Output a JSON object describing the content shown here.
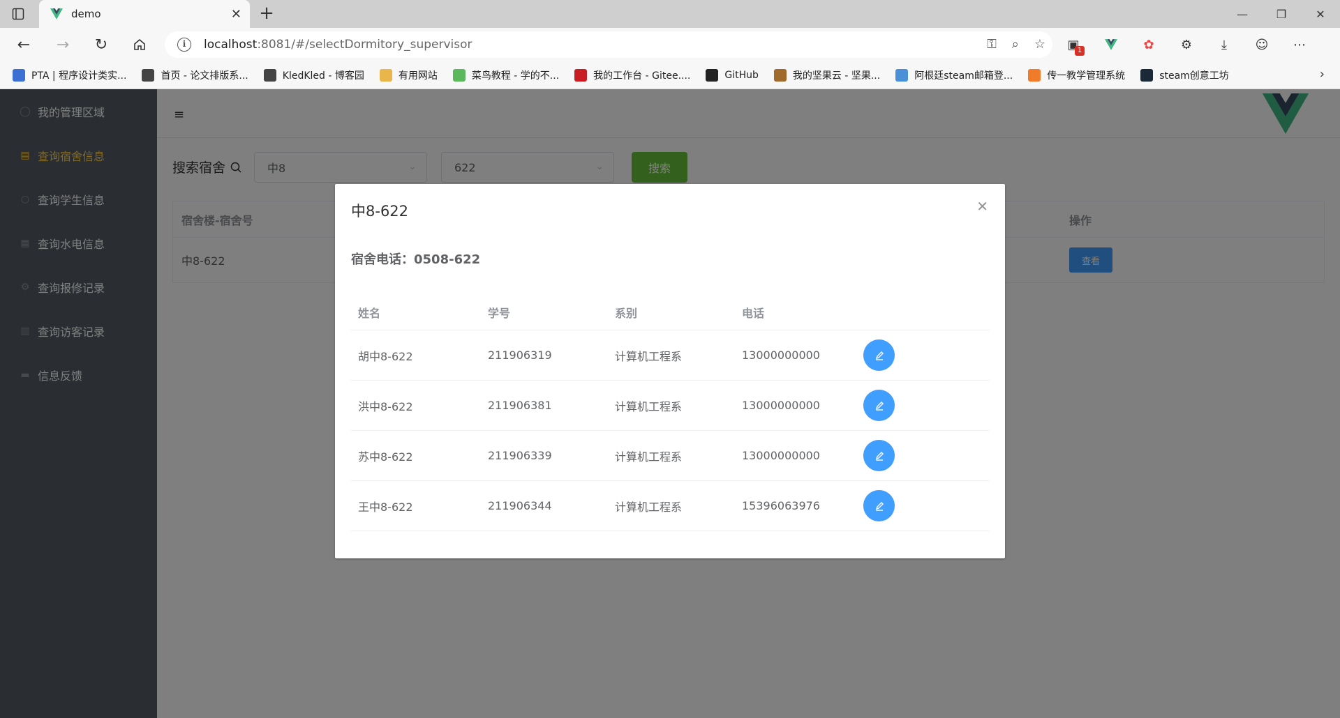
{
  "browser": {
    "tab_title": "demo",
    "url_host": "localhost",
    "url_rest": ":8081/#/selectDormitory_supervisor",
    "ext_badge": "1",
    "bookmarks": [
      {
        "label": "PTA | 程序设计类实...",
        "color": "#3b6fd1"
      },
      {
        "label": "首页 - 论文排版系...",
        "color": "#444444"
      },
      {
        "label": "KledKled - 博客园",
        "color": "#444444"
      },
      {
        "label": "有用网站",
        "color": "#e8b64a"
      },
      {
        "label": "菜鸟教程 - 学的不...",
        "color": "#5cb85c"
      },
      {
        "label": "我的工作台 - Gitee....",
        "color": "#c71d23"
      },
      {
        "label": "GitHub",
        "color": "#222222"
      },
      {
        "label": "我的坚果云 - 坚果...",
        "color": "#a06a2c"
      },
      {
        "label": "阿根廷steam邮箱登...",
        "color": "#4a90d9"
      },
      {
        "label": "传一教学管理系统",
        "color": "#f07c2a"
      },
      {
        "label": "steam创意工坊",
        "color": "#1b2838"
      }
    ]
  },
  "sidebar": {
    "items": [
      {
        "label": "我的管理区域",
        "icon": "user-icon",
        "glyph": "◯",
        "active": false
      },
      {
        "label": "查询宿舍信息",
        "icon": "building-icon",
        "glyph": "▤",
        "active": true
      },
      {
        "label": "查询学生信息",
        "icon": "search-icon",
        "glyph": "○",
        "active": false
      },
      {
        "label": "查询水电信息",
        "icon": "grid-icon",
        "glyph": "▦",
        "active": false
      },
      {
        "label": "查询报修记录",
        "icon": "gear-icon",
        "glyph": "⚙",
        "active": false
      },
      {
        "label": "查询访客记录",
        "icon": "document-icon",
        "glyph": "▥",
        "active": false
      },
      {
        "label": "信息反馈",
        "icon": "message-icon",
        "glyph": "▬",
        "active": false
      }
    ]
  },
  "search": {
    "label": "搜索宿舍",
    "building_value": "中8",
    "room_value": "622",
    "button_label": "搜索"
  },
  "table": {
    "headers": [
      "宿舍楼-宿舍号",
      "操作"
    ],
    "rows": [
      {
        "dorm": "中8-622",
        "action_label": "查看"
      }
    ]
  },
  "dialog": {
    "title": "中8-622",
    "phone_label": "宿舍电话：",
    "phone_value": "0508-622",
    "headers": [
      "姓名",
      "学号",
      "系别",
      "电话"
    ],
    "rows": [
      {
        "name": "胡中8-622",
        "id": "211906319",
        "dept": "计算机工程系",
        "phone": "13000000000"
      },
      {
        "name": "洪中8-622",
        "id": "211906381",
        "dept": "计算机工程系",
        "phone": "13000000000"
      },
      {
        "name": "苏中8-622",
        "id": "211906339",
        "dept": "计算机工程系",
        "phone": "13000000000"
      },
      {
        "name": "王中8-622",
        "id": "211906344",
        "dept": "计算机工程系",
        "phone": "15396063976"
      }
    ]
  },
  "colors": {
    "sidebar_bg": "#545c64",
    "active_menu": "#ffd04b",
    "primary": "#409eff",
    "success": "#67c23a"
  }
}
